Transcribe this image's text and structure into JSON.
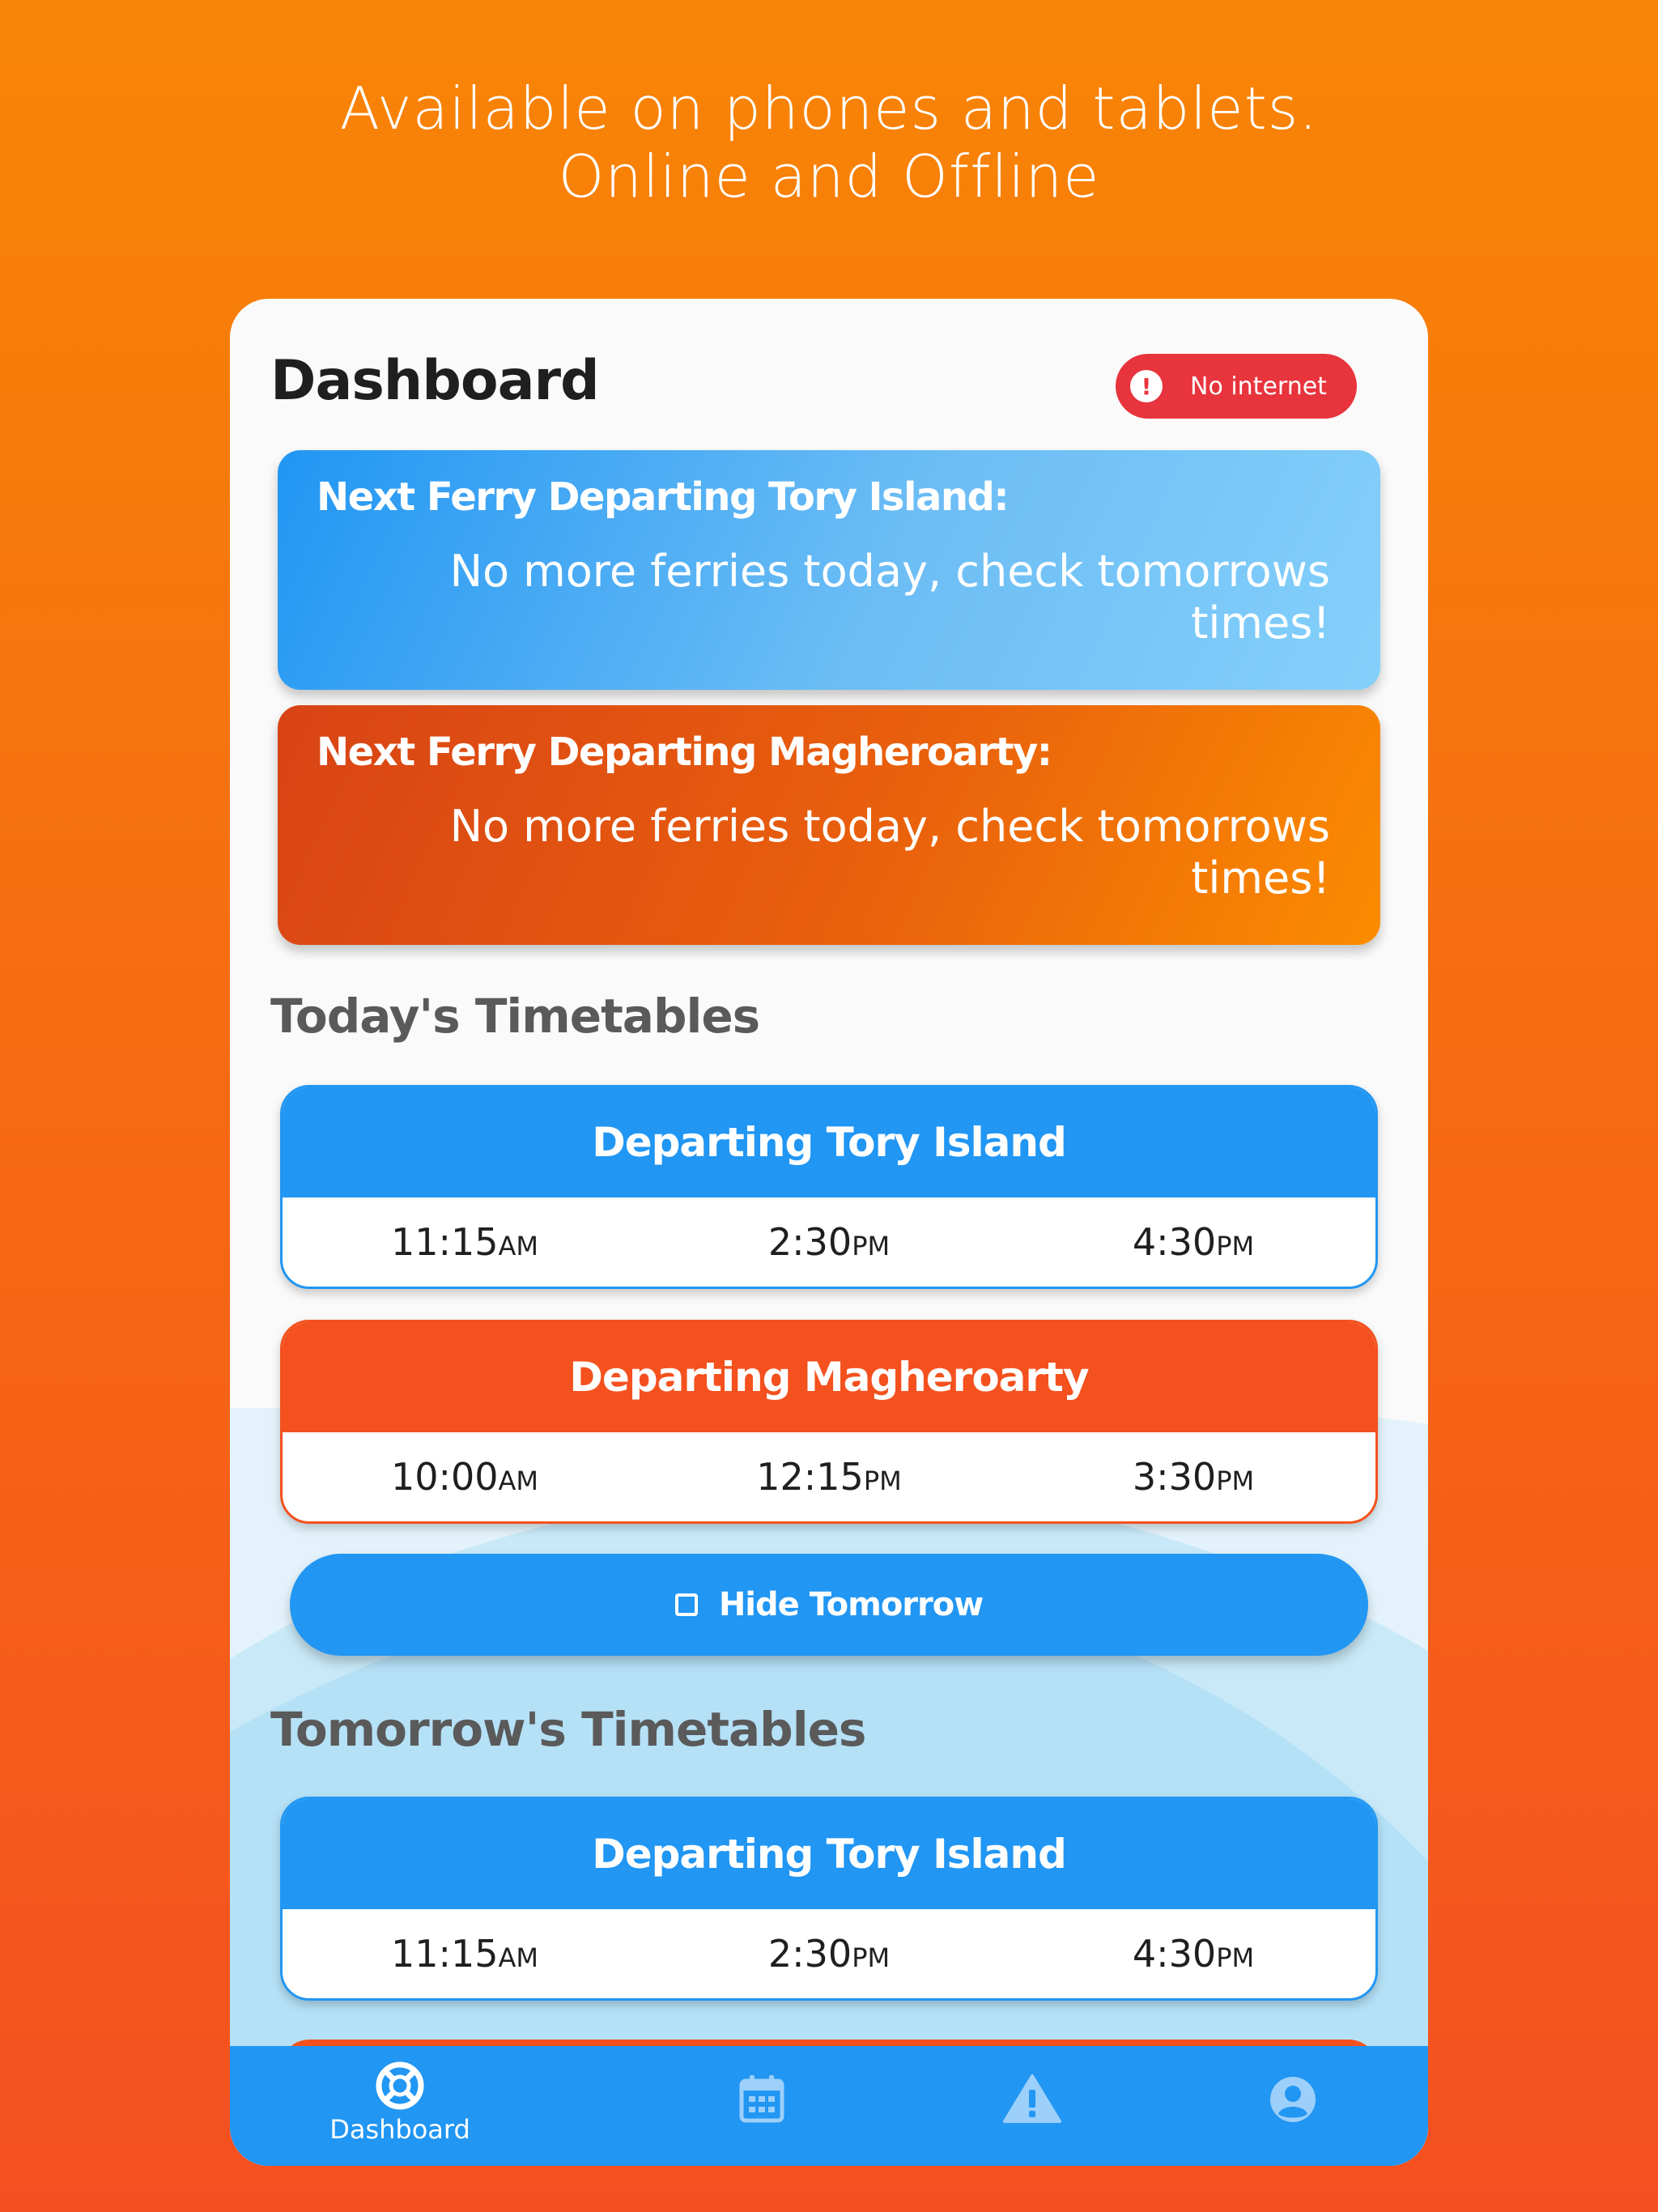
{
  "headline": {
    "line1": "Available on phones and tablets.",
    "line2": "Online and Offline"
  },
  "header": {
    "title": "Dashboard",
    "status_badge": "No internet",
    "status_icon": "exclamation-circle-icon"
  },
  "next_ferries": [
    {
      "label": "Next Ferry Departing Tory Island:",
      "message": "No more ferries today, check tomorrows times!",
      "color": "#2196f3"
    },
    {
      "label": "Next Ferry Departing Magheroarty:",
      "message": "No more ferries today, check tomorrows times!",
      "color": "#f4511e"
    }
  ],
  "today": {
    "title": "Today's Timetables",
    "timetables": [
      {
        "heading": "Departing Tory Island",
        "times": [
          {
            "time": "11:15",
            "ampm": "AM"
          },
          {
            "time": "2:30",
            "ampm": "PM"
          },
          {
            "time": "4:30",
            "ampm": "PM"
          }
        ]
      },
      {
        "heading": "Departing Magheroarty",
        "times": [
          {
            "time": "10:00",
            "ampm": "AM"
          },
          {
            "time": "12:15",
            "ampm": "PM"
          },
          {
            "time": "3:30",
            "ampm": "PM"
          }
        ]
      }
    ]
  },
  "toggle_button": {
    "label": "Hide Tomorrow",
    "icon": "calendar-icon"
  },
  "tomorrow": {
    "title": "Tomorrow's Timetables",
    "timetables": [
      {
        "heading": "Departing Tory Island",
        "times": [
          {
            "time": "11:15",
            "ampm": "AM"
          },
          {
            "time": "2:30",
            "ampm": "PM"
          },
          {
            "time": "4:30",
            "ampm": "PM"
          }
        ]
      }
    ]
  },
  "nav": {
    "items": [
      {
        "label": "Dashboard",
        "icon": "lifebuoy-icon",
        "active": true
      },
      {
        "label": "",
        "icon": "calendar-grid-icon",
        "active": false
      },
      {
        "label": "",
        "icon": "warning-triangle-icon",
        "active": false
      },
      {
        "label": "",
        "icon": "account-circle-icon",
        "active": false
      }
    ]
  },
  "colors": {
    "brand_blue": "#2196f3",
    "brand_orange": "#f4511e",
    "alert_red": "#e8343d"
  }
}
